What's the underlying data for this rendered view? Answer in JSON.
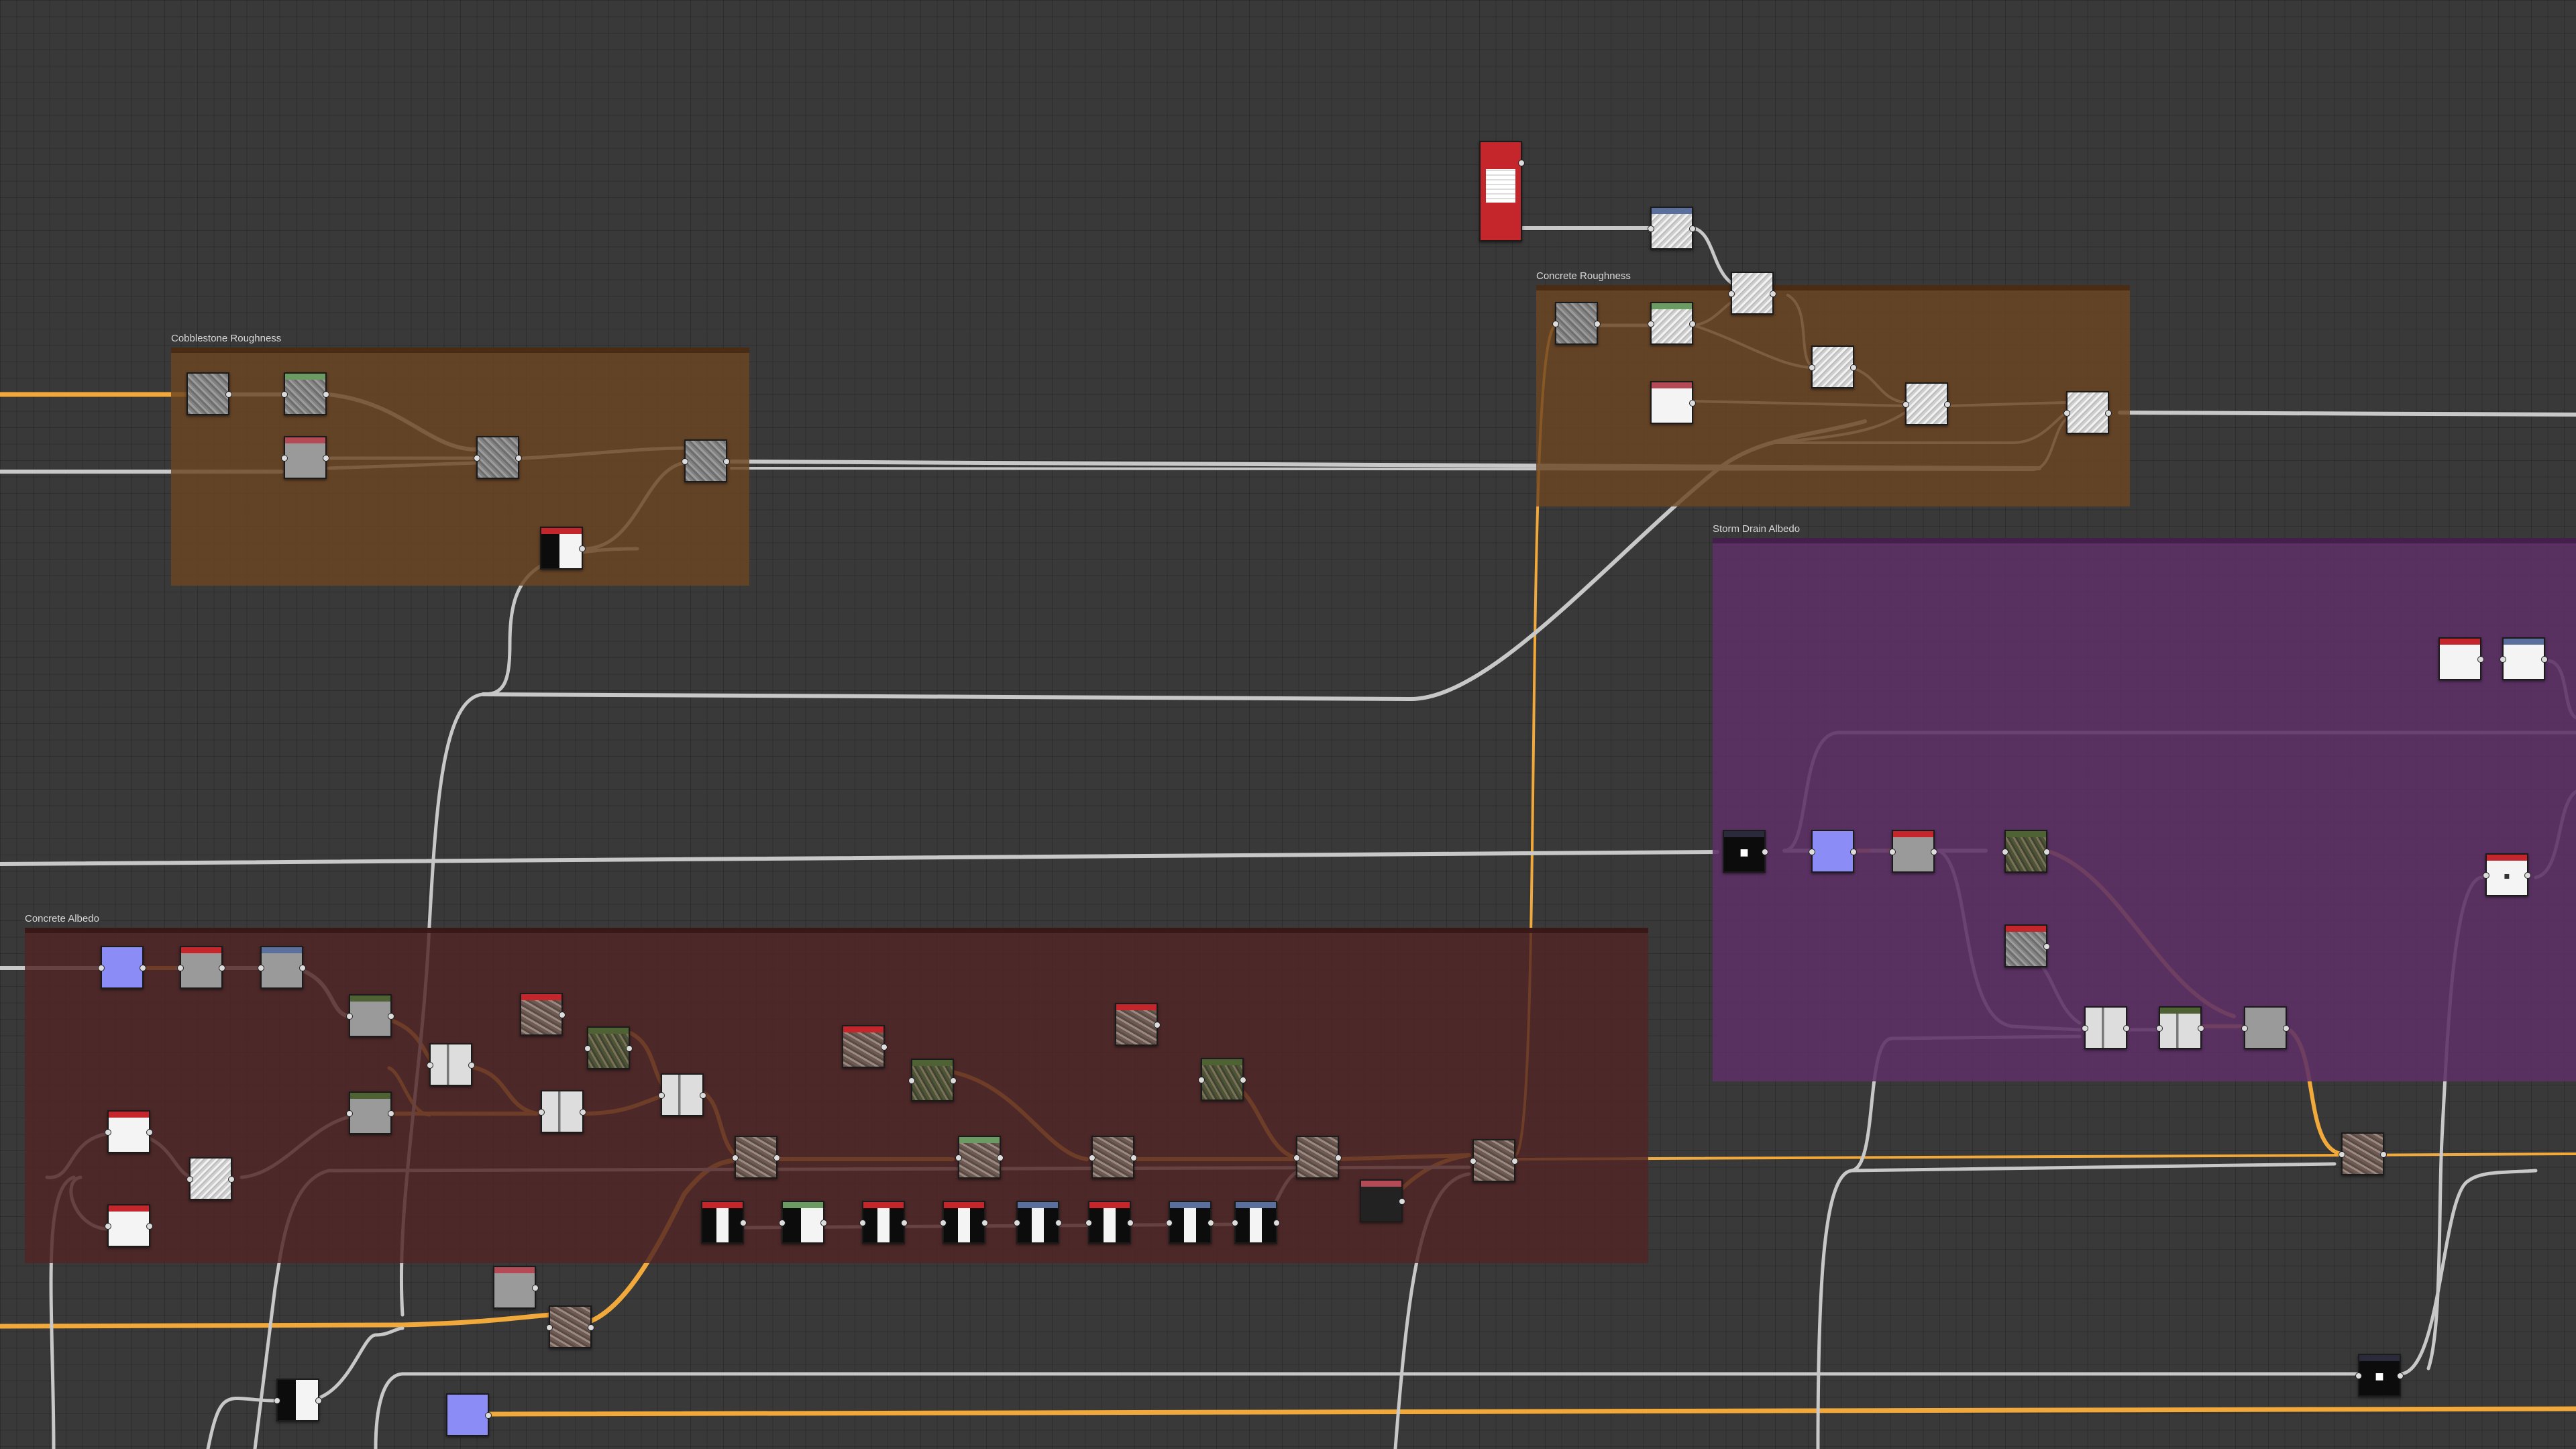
{
  "frames": {
    "cobblestone_roughness": {
      "title": "Cobblestone Roughness"
    },
    "concrete_roughness": {
      "title": "Concrete Roughness"
    },
    "storm_drain_albedo": {
      "title": "Storm Drain Albedo"
    },
    "concrete_albedo": {
      "title": "Concrete Albedo"
    }
  },
  "colors": {
    "canvas_background": "#393939",
    "wire_grayscale": "#c8c8c8",
    "wire_color": "#f2a93b",
    "frame_brown": "#6c4622",
    "frame_maroon": "#502424",
    "frame_purple": "#5c3066",
    "header_red": "#c4262b",
    "header_green": "#6b9a62",
    "header_blue": "#5a6f9c",
    "header_olive": "#4f6234",
    "header_dark": "#2a2a3a"
  },
  "node_types": {
    "red_header": "filter-node-red",
    "green_header": "blend-node-green",
    "blue_header": "adjust-node-blue",
    "output_card": "bitmap-output-node"
  }
}
